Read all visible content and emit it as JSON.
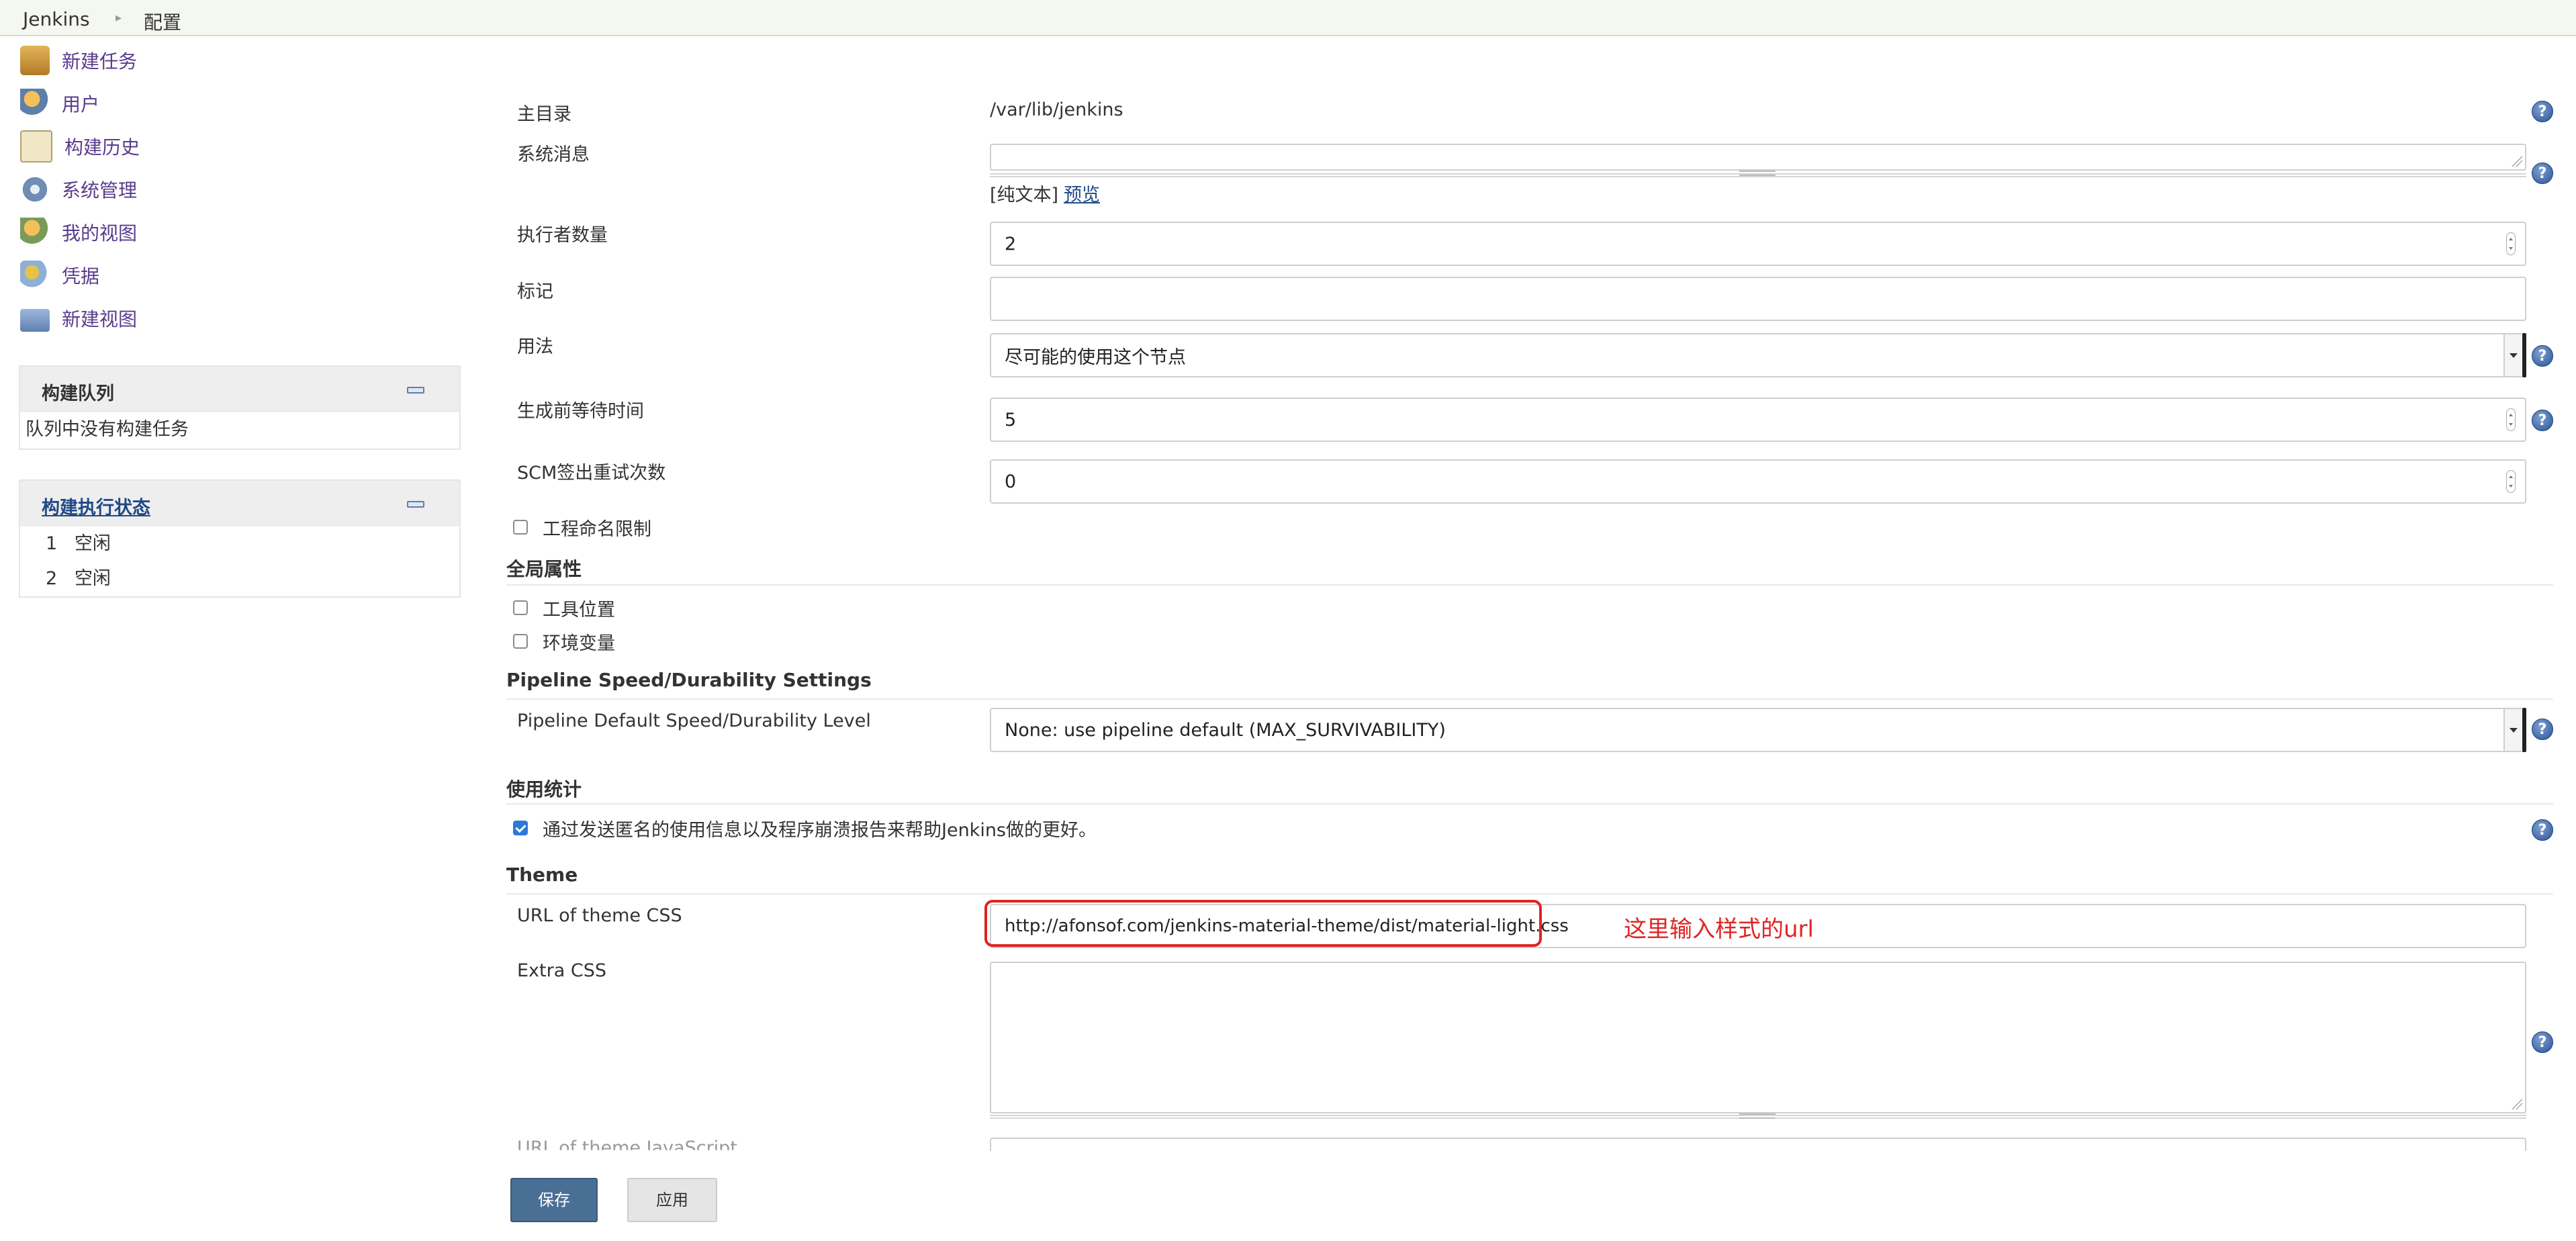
{
  "breadcrumb": {
    "root": "Jenkins",
    "current": "配置"
  },
  "sidebar": {
    "tasks": [
      {
        "label": "新建任务",
        "icon": "new-item-icon"
      },
      {
        "label": "用户",
        "icon": "users-icon"
      },
      {
        "label": "构建历史",
        "icon": "build-history-icon"
      },
      {
        "label": "系统管理",
        "icon": "gear-icon"
      },
      {
        "label": "我的视图",
        "icon": "my-views-icon"
      },
      {
        "label": "凭据",
        "icon": "credentials-icon"
      },
      {
        "label": "新建视图",
        "icon": "folder-icon"
      }
    ],
    "build_queue": {
      "title": "构建队列",
      "empty_text": "队列中没有构建任务"
    },
    "executor_status": {
      "title": "构建执行状态",
      "rows": [
        {
          "num": "1",
          "state": "空闲"
        },
        {
          "num": "2",
          "state": "空闲"
        }
      ]
    }
  },
  "form": {
    "home_dir": {
      "label": "主目录",
      "value": "/var/lib/jenkins"
    },
    "system_message": {
      "label": "系统消息",
      "format_text": "[纯文本]",
      "preview_link": "预览"
    },
    "executors": {
      "label": "执行者数量",
      "value": "2"
    },
    "labels": {
      "label": "标记",
      "value": ""
    },
    "usage": {
      "label": "用法",
      "value": "尽可能的使用这个节点"
    },
    "quiet_period": {
      "label": "生成前等待时间",
      "value": "5"
    },
    "scm_retry": {
      "label": "SCM签出重试次数",
      "value": "0"
    },
    "project_naming": {
      "label": "工程命名限制",
      "checked": false
    }
  },
  "global_properties": {
    "title": "全局属性",
    "tool_locations": {
      "label": "工具位置",
      "checked": false
    },
    "env_vars": {
      "label": "环境变量",
      "checked": false
    }
  },
  "pipeline": {
    "title": "Pipeline Speed/Durability Settings",
    "level_label": "Pipeline Default Speed/Durability Level",
    "level_value": "None: use pipeline default (MAX_SURVIVABILITY)"
  },
  "usage_stats": {
    "title": "使用统计",
    "checkbox_label": "通过发送匿名的使用信息以及程序崩溃报告来帮助Jenkins做的更好。",
    "checked": true
  },
  "theme": {
    "title": "Theme",
    "css_url_label": "URL of theme CSS",
    "css_url_value": "http://afonsof.com/jenkins-material-theme/dist/material-light.css",
    "extra_css_label": "Extra CSS",
    "js_url_label": "URL of theme JavaScript"
  },
  "annotation": {
    "text": "这里输入样式的url",
    "color": "#e02323"
  },
  "buttons": {
    "save": "保存",
    "apply": "应用"
  },
  "colors": {
    "link": "#204a87",
    "sidebar_link": "#5a3b8c",
    "save_bg": "#4a6f95",
    "help": "#2a5597"
  }
}
